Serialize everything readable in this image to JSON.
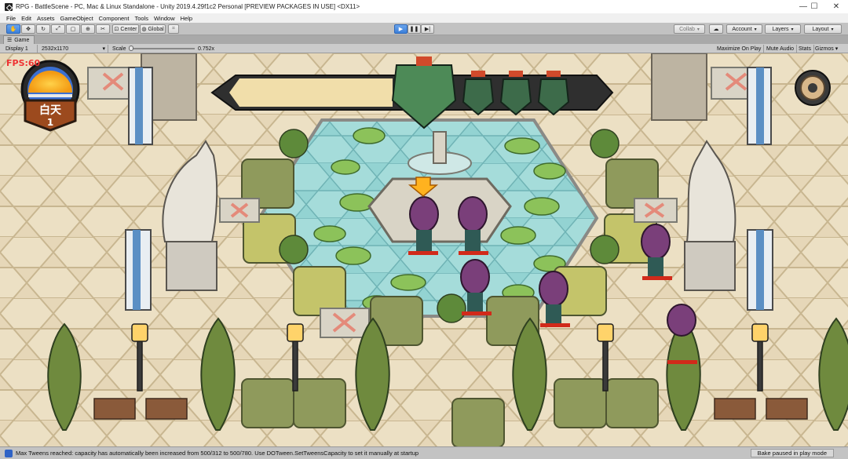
{
  "window": {
    "title": "RPG - BattleScene - PC, Mac & Linux Standalone - Unity 2019.4.29f1c2 Personal [PREVIEW PACKAGES IN USE] <DX11>",
    "minimize": "—",
    "maximize": "☐",
    "close": "✕"
  },
  "menu": [
    "File",
    "Edit",
    "Assets",
    "GameObject",
    "Component",
    "Tools",
    "Window",
    "Help"
  ],
  "toolbar": {
    "tools": [
      "hand-icon",
      "move-icon",
      "rotate-icon",
      "scale-icon",
      "rect-icon",
      "transform-icon",
      "custom-tool-icon"
    ],
    "pivot": "Center",
    "space": "Global",
    "play": "▶",
    "pause": "❚❚",
    "step": "▶|",
    "collab": "Collab",
    "account": "Account",
    "layers": "Layers",
    "layout": "Layout"
  },
  "game_tab": {
    "label": "Game"
  },
  "game_bar": {
    "display": "Display 1",
    "resolution": "2532x1170",
    "scale_label": "Scale",
    "scale_value": "0.752x",
    "scale_level": 0.0,
    "maximize": "Maximize On Play",
    "mute": "Mute Audio",
    "stats": "Stats",
    "gizmos": "Gizmos"
  },
  "game": {
    "fps": "FPS:60",
    "day_label": "白天",
    "day_number": "1",
    "enemy_count": 3,
    "hero_count": 6
  },
  "status": {
    "message": "Max Tweens reached: capacity has automatically been increased from 500/312 to 500/780. Use DOTween.SetTweensCapacity to set it manually at startup",
    "bake": "Bake paused in play mode"
  },
  "colors": {
    "accent_blue": "#3b7fd9",
    "floor": "#e6d7b8",
    "water": "#8fd0cf",
    "hedge": "#8f9a5c",
    "fps": "#e33333"
  }
}
